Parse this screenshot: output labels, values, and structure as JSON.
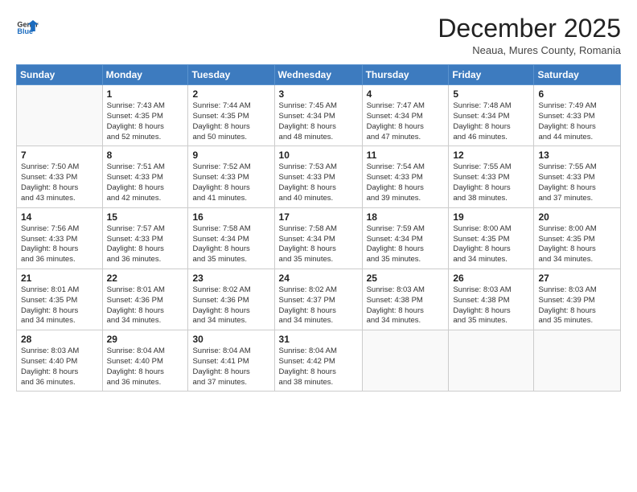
{
  "header": {
    "logo_line1": "General",
    "logo_line2": "Blue",
    "month_year": "December 2025",
    "location": "Neaua, Mures County, Romania"
  },
  "weekdays": [
    "Sunday",
    "Monday",
    "Tuesday",
    "Wednesday",
    "Thursday",
    "Friday",
    "Saturday"
  ],
  "weeks": [
    [
      {
        "day": "",
        "info": ""
      },
      {
        "day": "1",
        "info": "Sunrise: 7:43 AM\nSunset: 4:35 PM\nDaylight: 8 hours\nand 52 minutes."
      },
      {
        "day": "2",
        "info": "Sunrise: 7:44 AM\nSunset: 4:35 PM\nDaylight: 8 hours\nand 50 minutes."
      },
      {
        "day": "3",
        "info": "Sunrise: 7:45 AM\nSunset: 4:34 PM\nDaylight: 8 hours\nand 48 minutes."
      },
      {
        "day": "4",
        "info": "Sunrise: 7:47 AM\nSunset: 4:34 PM\nDaylight: 8 hours\nand 47 minutes."
      },
      {
        "day": "5",
        "info": "Sunrise: 7:48 AM\nSunset: 4:34 PM\nDaylight: 8 hours\nand 46 minutes."
      },
      {
        "day": "6",
        "info": "Sunrise: 7:49 AM\nSunset: 4:33 PM\nDaylight: 8 hours\nand 44 minutes."
      }
    ],
    [
      {
        "day": "7",
        "info": "Sunrise: 7:50 AM\nSunset: 4:33 PM\nDaylight: 8 hours\nand 43 minutes."
      },
      {
        "day": "8",
        "info": "Sunrise: 7:51 AM\nSunset: 4:33 PM\nDaylight: 8 hours\nand 42 minutes."
      },
      {
        "day": "9",
        "info": "Sunrise: 7:52 AM\nSunset: 4:33 PM\nDaylight: 8 hours\nand 41 minutes."
      },
      {
        "day": "10",
        "info": "Sunrise: 7:53 AM\nSunset: 4:33 PM\nDaylight: 8 hours\nand 40 minutes."
      },
      {
        "day": "11",
        "info": "Sunrise: 7:54 AM\nSunset: 4:33 PM\nDaylight: 8 hours\nand 39 minutes."
      },
      {
        "day": "12",
        "info": "Sunrise: 7:55 AM\nSunset: 4:33 PM\nDaylight: 8 hours\nand 38 minutes."
      },
      {
        "day": "13",
        "info": "Sunrise: 7:55 AM\nSunset: 4:33 PM\nDaylight: 8 hours\nand 37 minutes."
      }
    ],
    [
      {
        "day": "14",
        "info": "Sunrise: 7:56 AM\nSunset: 4:33 PM\nDaylight: 8 hours\nand 36 minutes."
      },
      {
        "day": "15",
        "info": "Sunrise: 7:57 AM\nSunset: 4:33 PM\nDaylight: 8 hours\nand 36 minutes."
      },
      {
        "day": "16",
        "info": "Sunrise: 7:58 AM\nSunset: 4:34 PM\nDaylight: 8 hours\nand 35 minutes."
      },
      {
        "day": "17",
        "info": "Sunrise: 7:58 AM\nSunset: 4:34 PM\nDaylight: 8 hours\nand 35 minutes."
      },
      {
        "day": "18",
        "info": "Sunrise: 7:59 AM\nSunset: 4:34 PM\nDaylight: 8 hours\nand 35 minutes."
      },
      {
        "day": "19",
        "info": "Sunrise: 8:00 AM\nSunset: 4:35 PM\nDaylight: 8 hours\nand 34 minutes."
      },
      {
        "day": "20",
        "info": "Sunrise: 8:00 AM\nSunset: 4:35 PM\nDaylight: 8 hours\nand 34 minutes."
      }
    ],
    [
      {
        "day": "21",
        "info": "Sunrise: 8:01 AM\nSunset: 4:35 PM\nDaylight: 8 hours\nand 34 minutes."
      },
      {
        "day": "22",
        "info": "Sunrise: 8:01 AM\nSunset: 4:36 PM\nDaylight: 8 hours\nand 34 minutes."
      },
      {
        "day": "23",
        "info": "Sunrise: 8:02 AM\nSunset: 4:36 PM\nDaylight: 8 hours\nand 34 minutes."
      },
      {
        "day": "24",
        "info": "Sunrise: 8:02 AM\nSunset: 4:37 PM\nDaylight: 8 hours\nand 34 minutes."
      },
      {
        "day": "25",
        "info": "Sunrise: 8:03 AM\nSunset: 4:38 PM\nDaylight: 8 hours\nand 34 minutes."
      },
      {
        "day": "26",
        "info": "Sunrise: 8:03 AM\nSunset: 4:38 PM\nDaylight: 8 hours\nand 35 minutes."
      },
      {
        "day": "27",
        "info": "Sunrise: 8:03 AM\nSunset: 4:39 PM\nDaylight: 8 hours\nand 35 minutes."
      }
    ],
    [
      {
        "day": "28",
        "info": "Sunrise: 8:03 AM\nSunset: 4:40 PM\nDaylight: 8 hours\nand 36 minutes."
      },
      {
        "day": "29",
        "info": "Sunrise: 8:04 AM\nSunset: 4:40 PM\nDaylight: 8 hours\nand 36 minutes."
      },
      {
        "day": "30",
        "info": "Sunrise: 8:04 AM\nSunset: 4:41 PM\nDaylight: 8 hours\nand 37 minutes."
      },
      {
        "day": "31",
        "info": "Sunrise: 8:04 AM\nSunset: 4:42 PM\nDaylight: 8 hours\nand 38 minutes."
      },
      {
        "day": "",
        "info": ""
      },
      {
        "day": "",
        "info": ""
      },
      {
        "day": "",
        "info": ""
      }
    ]
  ]
}
